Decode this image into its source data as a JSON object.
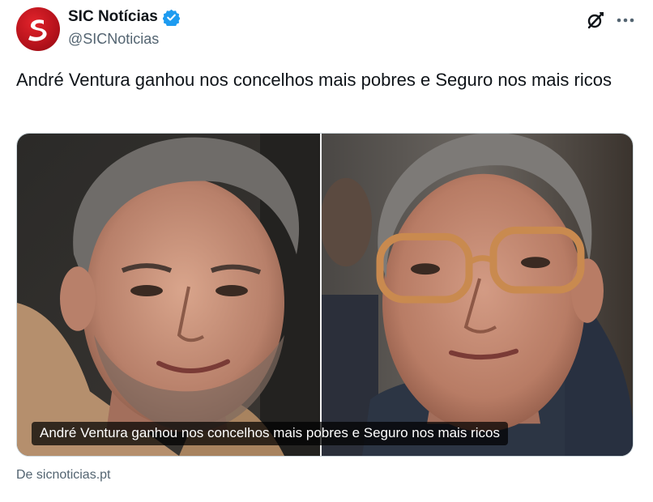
{
  "account": {
    "display_name": "SIC Notícias",
    "handle": "@SICNoticias",
    "verified": true,
    "avatar_icon": "sic-logo-icon",
    "brand_color": "#c8141c",
    "verified_color": "#1d9bf0"
  },
  "actions": {
    "grok_icon": "grok-icon",
    "more_icon": "more-horizontal-icon"
  },
  "tweet": {
    "text": "André Ventura ganhou nos concelhos mais pobres e Seguro nos mais ricos"
  },
  "media_card": {
    "caption": "André Ventura ganhou nos concelhos mais pobres e Seguro nos mais ricos",
    "images": [
      "portrait-left",
      "portrait-right"
    ]
  },
  "source": {
    "label": "De sicnoticias.pt"
  }
}
